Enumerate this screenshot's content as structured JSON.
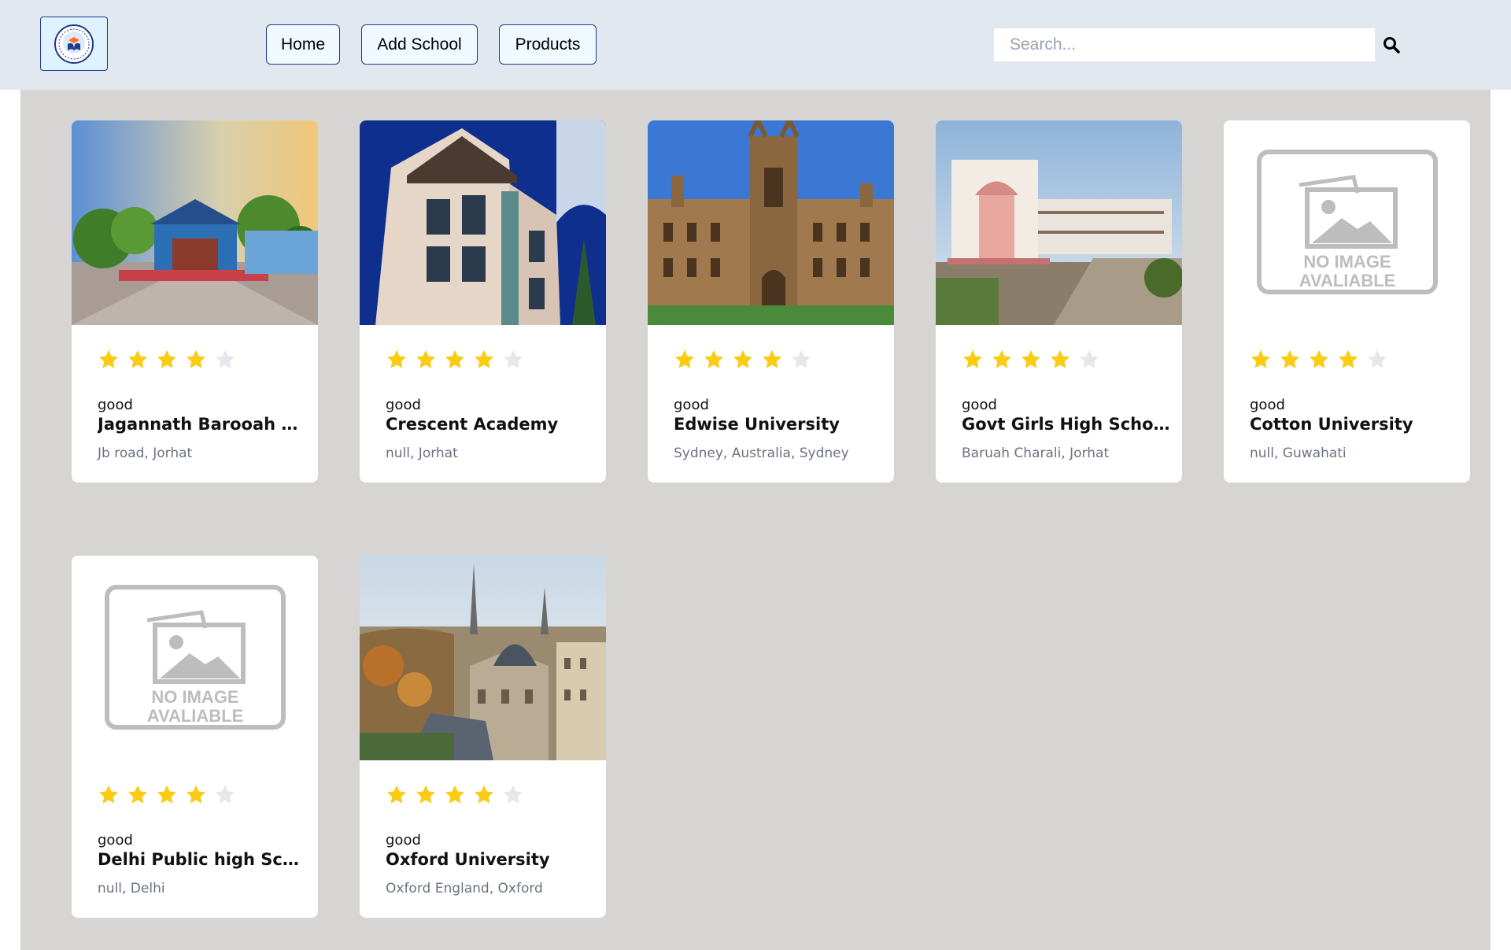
{
  "nav": {
    "logo_alt": "school logo",
    "items": [
      {
        "label": "Home"
      },
      {
        "label": "Add School"
      },
      {
        "label": "Products"
      }
    ],
    "search": {
      "placeholder": "Search...",
      "value": ""
    }
  },
  "cards": [
    {
      "rating_label": "good",
      "stars": 4,
      "max_stars": 5,
      "name": "Jagannath Barooah Coll...",
      "location": "Jb road, Jorhat",
      "image": "college-campus-photo"
    },
    {
      "rating_label": "good",
      "stars": 4,
      "max_stars": 5,
      "name": "Crescent Academy",
      "location": "null, Jorhat",
      "image": "academy-building-photo"
    },
    {
      "rating_label": "good",
      "stars": 4,
      "max_stars": 5,
      "name": "Edwise University",
      "location": "Sydney, Australia, Sydney",
      "image": "gothic-university-photo"
    },
    {
      "rating_label": "good",
      "stars": 4,
      "max_stars": 5,
      "name": "Govt Girls High School",
      "location": "Baruah Charali, Jorhat",
      "image": "school-building-photo"
    },
    {
      "rating_label": "good",
      "stars": 4,
      "max_stars": 5,
      "name": "Cotton University",
      "location": "null, Guwahati",
      "image": "no-image-placeholder",
      "placeholder_text": [
        "NO IMAGE",
        "AVALIABLE"
      ]
    },
    {
      "rating_label": "good",
      "stars": 4,
      "max_stars": 5,
      "name": "Delhi Public high School",
      "location": "null, Delhi",
      "image": "no-image-placeholder",
      "placeholder_text": [
        "NO IMAGE",
        "AVALIABLE"
      ]
    },
    {
      "rating_label": "good",
      "stars": 4,
      "max_stars": 5,
      "name": "Oxford University",
      "location": "Oxford England, Oxford",
      "image": "oxford-city-photo"
    }
  ],
  "colors": {
    "navbar_bg": "#e2e8f0",
    "content_bg": "#d6d5d4",
    "star_filled": "#facc15",
    "star_empty": "#e5e7eb",
    "button_border": "#1e3a8a"
  }
}
